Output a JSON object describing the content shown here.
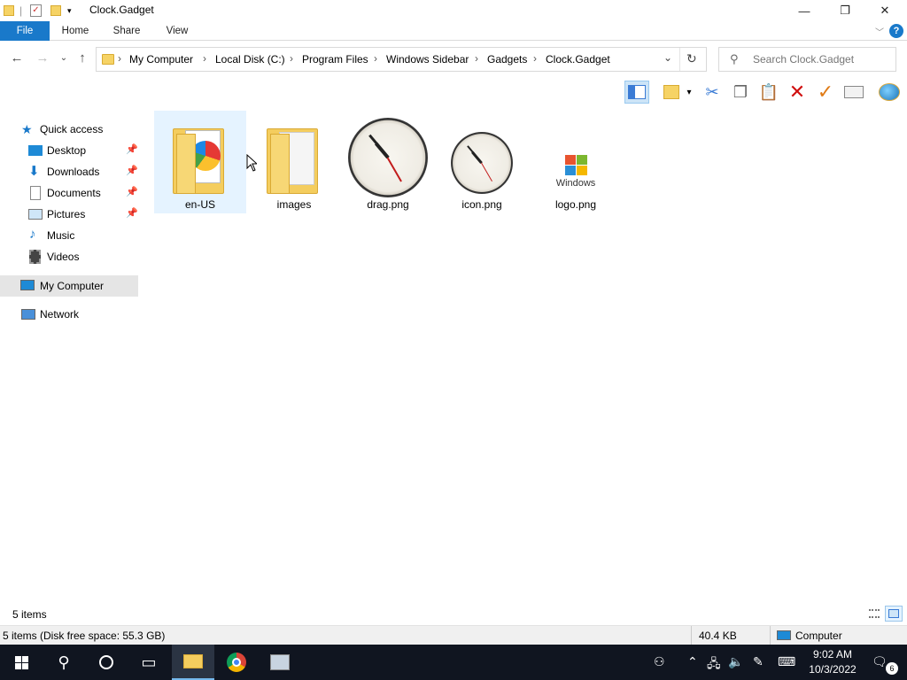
{
  "window": {
    "title": "Clock.Gadget",
    "minimize_glyph": "—",
    "restore_glyph": "❐",
    "close_glyph": "✕"
  },
  "ribbon": {
    "tabs": [
      {
        "label": "File"
      },
      {
        "label": "Home"
      },
      {
        "label": "Share"
      },
      {
        "label": "View"
      }
    ],
    "help_glyph": "?"
  },
  "address": {
    "breadcrumbs": [
      "My Computer",
      "Local Disk (C:)",
      "Program Files",
      "Windows Sidebar",
      "Gadgets",
      "Clock.Gadget"
    ],
    "separator": "›"
  },
  "search": {
    "placeholder": "Search Clock.Gadget"
  },
  "navigation": {
    "items": [
      {
        "label": "Quick access",
        "icon": "star-icon",
        "pinned": false
      },
      {
        "label": "Desktop",
        "icon": "desktop-icon",
        "pinned": true
      },
      {
        "label": "Downloads",
        "icon": "download-icon",
        "pinned": true
      },
      {
        "label": "Documents",
        "icon": "documents-icon",
        "pinned": true
      },
      {
        "label": "Pictures",
        "icon": "pictures-icon",
        "pinned": true
      },
      {
        "label": "Music",
        "icon": "music-icon",
        "pinned": false
      },
      {
        "label": "Videos",
        "icon": "videos-icon",
        "pinned": false
      },
      {
        "label": "My Computer",
        "icon": "computer-icon",
        "selected": true
      },
      {
        "label": "Network",
        "icon": "network-icon"
      }
    ]
  },
  "files": [
    {
      "name": "en-US",
      "type": "folder"
    },
    {
      "name": "images",
      "type": "folder"
    },
    {
      "name": "drag.png",
      "type": "image"
    },
    {
      "name": "icon.png",
      "type": "image"
    },
    {
      "name": "logo.png",
      "type": "image"
    }
  ],
  "logo_text": "Windows",
  "status": {
    "item_count": "5 items",
    "details": "5 items (Disk free space: 55.3 GB)",
    "size": "40.4 KB",
    "location": "Computer"
  },
  "taskbar": {
    "time": "9:02 AM",
    "date": "10/3/2022",
    "notification_count": "6"
  },
  "colors": {
    "accent": "#1979ca",
    "selection": "#e5f3ff",
    "taskbar": "#101520"
  }
}
